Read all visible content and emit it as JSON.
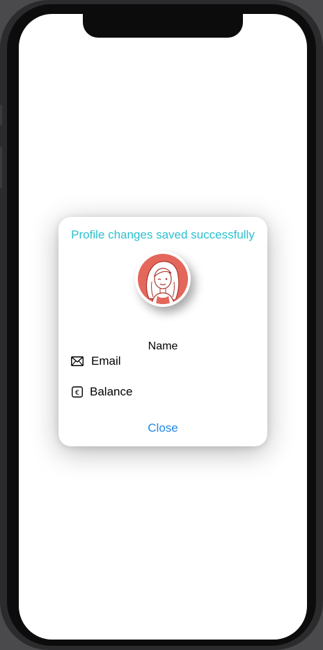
{
  "dialog": {
    "message": "Profile changes saved successfully",
    "name_label": "Name",
    "email_label": "Email",
    "balance_label": "Balance",
    "close_label": "Close"
  },
  "icons": {
    "email": "envelope-icon",
    "balance": "euro-icon",
    "avatar": "avatar-illustration"
  },
  "colors": {
    "message": "#2bc0d0",
    "close": "#1e88e5",
    "avatar_bg": "#e4675b"
  }
}
